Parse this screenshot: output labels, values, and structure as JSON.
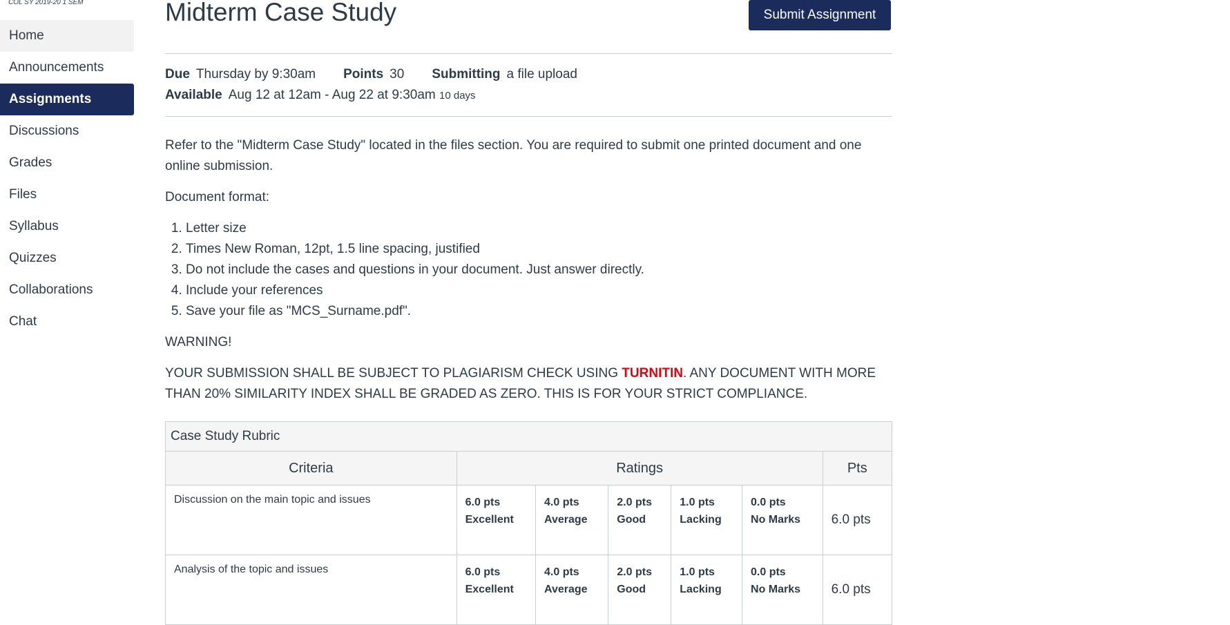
{
  "course": {
    "label": "COL SY 2019-20 1 SEM"
  },
  "nav": {
    "items": [
      {
        "label": "Home"
      },
      {
        "label": "Announcements"
      },
      {
        "label": "Assignments"
      },
      {
        "label": "Discussions"
      },
      {
        "label": "Grades"
      },
      {
        "label": "Files"
      },
      {
        "label": "Syllabus"
      },
      {
        "label": "Quizzes"
      },
      {
        "label": "Collaborations"
      },
      {
        "label": "Chat"
      }
    ],
    "active": "Assignments",
    "hovered": "Home"
  },
  "assignment": {
    "title": "Midterm Case Study",
    "submit_label": "Submit Assignment",
    "due_label": "Due",
    "due_value": "Thursday by 9:30am",
    "points_label": "Points",
    "points_value": "30",
    "submitting_label": "Submitting",
    "submitting_value": "a file upload",
    "available_label": "Available",
    "available_value": "Aug 12 at 12am - Aug 22 at 9:30am",
    "available_duration": "10 days"
  },
  "content": {
    "intro": "Refer to the \"Midterm Case Study\" located in the files section. You are  required to submit one printed document and one online submission.",
    "format_heading": "Document format:",
    "format_items": [
      "Letter size",
      "Times New Roman, 12pt, 1.5 line spacing, justified",
      "Do not include the cases and questions in your document. Just answer directly.",
      "Include your references",
      "Save your file as \"MCS_Surname.pdf\"."
    ],
    "warning": "WARNING!",
    "notice_before": "YOUR SUBMISSION SHALL BE SUBJECT TO PLAGIARISM CHECK USING ",
    "notice_highlight": "TURNITIN",
    "notice_after": ". ANY DOCUMENT WITH MORE THAN 20% SIMILARITY INDEX SHALL BE GRADED AS ZERO. THIS IS FOR YOUR STRICT COMPLIANCE.",
    "highlight_color": "#e8000d"
  },
  "rubric": {
    "title": "Case Study Rubric",
    "headers": [
      "Criteria",
      "Ratings",
      "Pts"
    ],
    "rows": [
      {
        "criterion": "Discussion on the main topic and issues",
        "ratings": [
          {
            "pts": "6.0 pts",
            "desc": "Excellent"
          },
          {
            "pts": "4.0 pts",
            "desc": "Average"
          },
          {
            "pts": "2.0 pts",
            "desc": "Good"
          },
          {
            "pts": "1.0 pts",
            "desc": "Lacking"
          },
          {
            "pts": "0.0 pts",
            "desc": "No Marks"
          }
        ],
        "points": "6.0 pts"
      },
      {
        "criterion": "Analysis of the topic and issues",
        "ratings": [
          {
            "pts": "6.0 pts",
            "desc": "Excellent"
          },
          {
            "pts": "4.0 pts",
            "desc": "Average"
          },
          {
            "pts": "2.0 pts",
            "desc": "Good"
          },
          {
            "pts": "1.0 pts",
            "desc": "Lacking"
          },
          {
            "pts": "0.0 pts",
            "desc": "No Marks"
          }
        ],
        "points": "6.0 pts"
      }
    ]
  },
  "colors": {
    "primary": "#1b2b5b",
    "text": "#2d3b45",
    "border": "#c7cdd1"
  }
}
